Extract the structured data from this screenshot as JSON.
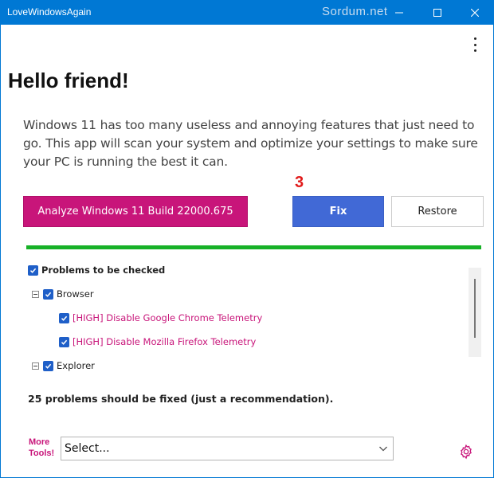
{
  "titlebar": {
    "title": "LoveWindowsAgain",
    "watermark": "Sordum.net"
  },
  "header": {
    "greeting": "Hello friend!",
    "intro": "Windows 11 has too many useless and annoying features that just need to go. This app will scan your system and optimize your settings to make sure your PC is running the best it can."
  },
  "actions": {
    "analyze_label": "Analyze Windows 11 Build 22000.675",
    "fix_label": "Fix",
    "restore_label": "Restore",
    "step_annotation": "3"
  },
  "progress": {
    "value_percent": 100,
    "color": "#17b127"
  },
  "tree": {
    "root": {
      "label": "Problems to be checked",
      "checked": true
    },
    "groups": [
      {
        "label": "Browser",
        "checked": true,
        "expanded": true,
        "items": [
          {
            "label": "[HIGH] Disable Google Chrome Telemetry",
            "checked": true
          },
          {
            "label": "[HIGH] Disable Mozilla Firefox Telemetry",
            "checked": true
          }
        ]
      },
      {
        "label": "Explorer",
        "checked": true,
        "expanded": true,
        "items": []
      }
    ]
  },
  "summary": "25 problems should be fixed (just a recommendation).",
  "footer": {
    "more_tools_line1": "More",
    "more_tools_line2": "Tools!",
    "select_value": "Select..."
  },
  "colors": {
    "accent_blue": "#0078d4",
    "accent_pink": "#c8157a",
    "fix_blue": "#4169d6",
    "annotation_red": "#e11a1a"
  },
  "icons": [
    "minimize-icon",
    "maximize-icon",
    "close-icon",
    "more-vertical-icon",
    "checkbox-icon",
    "collapse-icon",
    "chevron-down-icon",
    "gear-icon"
  ]
}
